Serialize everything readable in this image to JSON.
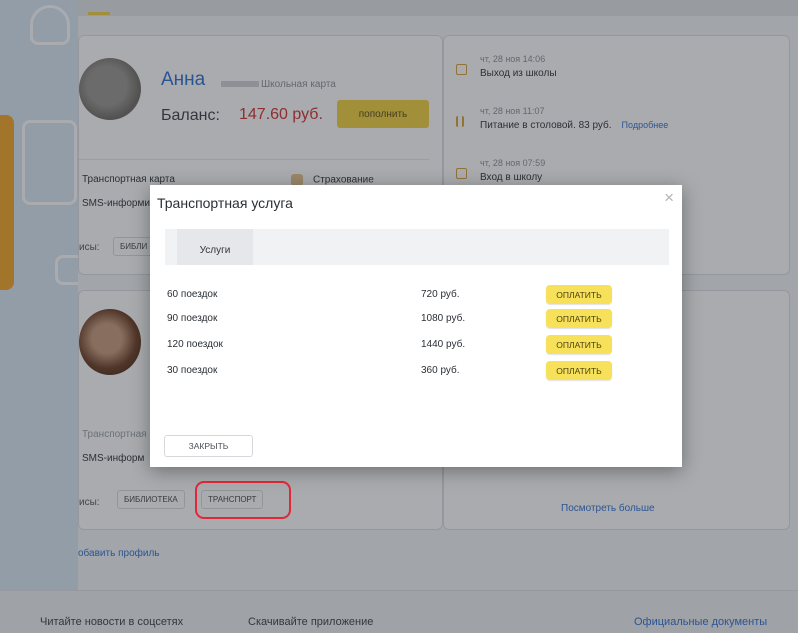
{
  "profile1": {
    "name": "Анна",
    "card_type": "Школьная карта",
    "balance_label": "Баланс:",
    "balance_value": "147.60 руб.",
    "topup_label": "пополнить",
    "feature_transport": "Транспортная карта",
    "feature_insurance": "Страхование",
    "feature_sms": "SMS-информи",
    "services_label": "исы:",
    "chip_library": "БИБЛИ"
  },
  "events": [
    {
      "time": "чт, 28 ноя 14:06",
      "title": "Выход из школы"
    },
    {
      "time": "чт, 28 ноя 11:07",
      "title": "Питание в столовой. 83 руб.",
      "more": "Подробнее"
    },
    {
      "time": "чт, 28 ноя 07:59",
      "title": "Вход в школу"
    }
  ],
  "profile2": {
    "feature_transport": "Транспортная",
    "feature_sms": "SMS-информ",
    "services_label": "исы:",
    "chip_library": "БИБЛИОТЕКА",
    "chip_transport": "ТРАНСПОРТ",
    "more_link": "Посмотреть больше"
  },
  "add_profile": "обавить профиль",
  "footer": {
    "news": "Читайте новости в соцсетях",
    "app": "Скачивайте приложение",
    "docs": "Официальные документы"
  },
  "modal": {
    "title": "Транспортная услуга",
    "close_icon": "×",
    "tab_label": "Услуги",
    "services": [
      {
        "name": "60 поездок",
        "price": "720 руб.",
        "action": "ОПЛАТИТЬ"
      },
      {
        "name": "90 поездок",
        "price": "1080 руб.",
        "action": "ОПЛАТИТЬ"
      },
      {
        "name": "120 поездок",
        "price": "1440 руб.",
        "action": "ОПЛАТИТЬ"
      },
      {
        "name": "30 поездок",
        "price": "360 руб.",
        "action": "ОПЛАТИТЬ"
      }
    ],
    "close_label": "ЗАКРЫТЬ"
  },
  "colors": {
    "accent_blue": "#2f6fd3",
    "balance_red": "#d62d2d",
    "button_yellow": "#f7e15a",
    "highlight_red": "#e0283a"
  }
}
